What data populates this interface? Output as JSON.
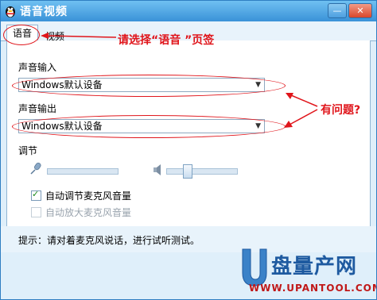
{
  "window": {
    "title": "语音视频",
    "min_glyph": "—",
    "close_glyph": "✕"
  },
  "tabs": [
    {
      "label": "语音",
      "active": true
    },
    {
      "label": "视频",
      "active": false
    }
  ],
  "annotations": {
    "tab_hint": "请选择“语音 ”页签",
    "question": "有问题?"
  },
  "audio": {
    "input_label": "声音输入",
    "input_value": "Windows默认设备",
    "output_label": "声音输出",
    "output_value": "Windows默认设备",
    "adjust_label": "调节",
    "mic_level": 0.0,
    "speaker_level": 0.27
  },
  "options": [
    {
      "label": "自动调节麦克风音量",
      "checked": true,
      "enabled": true
    },
    {
      "label": "自动放大麦克风音量",
      "checked": false,
      "enabled": false
    }
  ],
  "hint": "提示：请对着麦克风说话，进行试听测试。",
  "watermark": {
    "brand": "盘量产网",
    "url": "WWW.UPANTOOL.COM"
  },
  "colors": {
    "accent": "#3a92d8",
    "annotation": "#e0151b"
  }
}
